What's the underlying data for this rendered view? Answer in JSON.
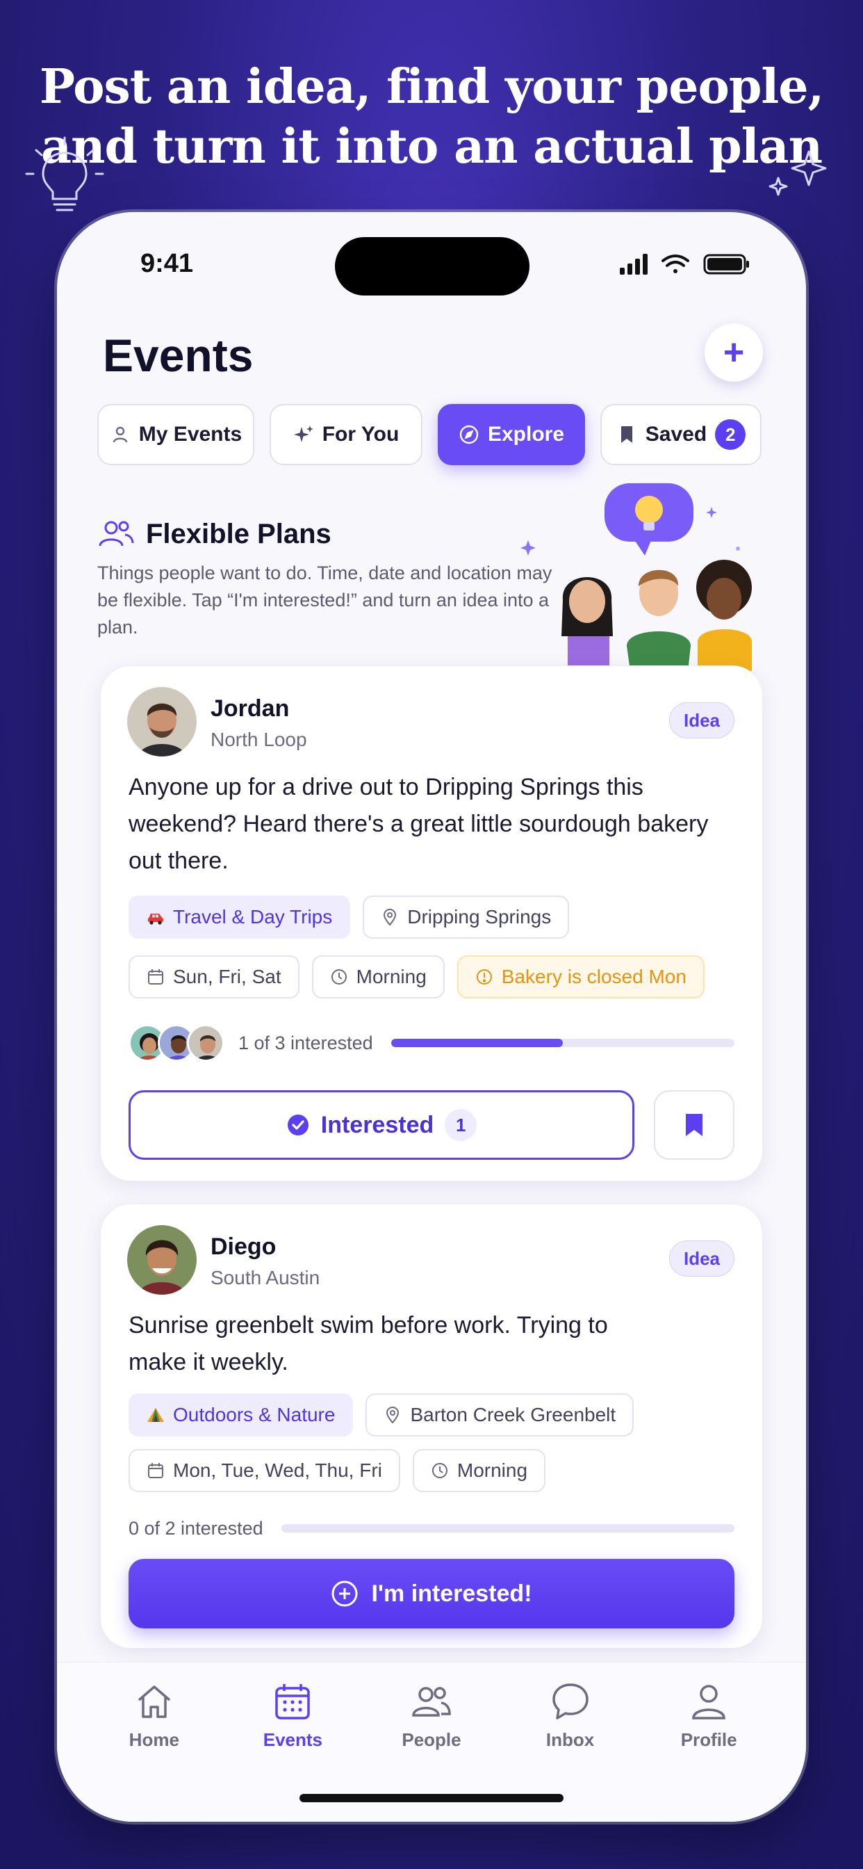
{
  "headline": {
    "line1": "Post an idea, find your people,",
    "line2": "and turn it into an actual plan"
  },
  "status_bar": {
    "time": "9:41"
  },
  "page": {
    "title": "Events",
    "add_icon": "plus-icon"
  },
  "tabs": [
    {
      "label": "My Events",
      "icon": "person-icon"
    },
    {
      "label": "For You",
      "icon": "sparkle-icon"
    },
    {
      "label": "Explore",
      "icon": "compass-icon",
      "active": true
    },
    {
      "label": "Saved",
      "icon": "bookmark-icon",
      "badge": "2"
    }
  ],
  "flexible_plans": {
    "title": "Flexible Plans",
    "icon": "people-icon",
    "description": "Things people want to do. Time, date and location may be flexible. Tap “I'm interested!” and turn an idea into a plan."
  },
  "cards": [
    {
      "name": "Jordan",
      "location": "North Loop",
      "tag": "Idea",
      "text": "Anyone up for a drive out to Dripping Springs this weekend? Heard there's a great little sourdough bakery out there.",
      "category": "Travel & Day Trips",
      "category_icon": "car-icon",
      "place": "Dripping Springs",
      "days": "Sun, Fri, Sat",
      "time": "Morning",
      "warning": "Bakery is closed Mon",
      "interest_text": "1 of 3 interested",
      "interest_fraction": 0.5,
      "button_label": "Interested",
      "button_count": "1"
    },
    {
      "name": "Diego",
      "location": "South Austin",
      "tag": "Idea",
      "text": "Sunrise greenbelt swim before work. Trying to make it weekly.",
      "category": "Outdoors & Nature",
      "category_icon": "tent-icon",
      "place": "Barton Creek Greenbelt",
      "days": "Mon, Tue, Wed, Thu, Fri",
      "time": "Morning",
      "interest_text": "0 of 2 interested",
      "interest_fraction": 0,
      "button_label": "I'm interested!"
    }
  ],
  "tabbar": [
    {
      "label": "Home",
      "icon": "home-icon"
    },
    {
      "label": "Events",
      "icon": "calendar-icon",
      "active": true
    },
    {
      "label": "People",
      "icon": "people-icon"
    },
    {
      "label": "Inbox",
      "icon": "chat-bubble-icon"
    },
    {
      "label": "Profile",
      "icon": "profile-icon"
    }
  ],
  "colors": {
    "accent": "#5B3FF0",
    "warning": "#E39512",
    "background": "#2B2185"
  }
}
